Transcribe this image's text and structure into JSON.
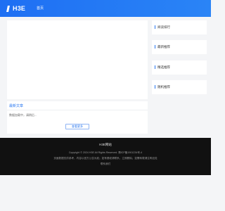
{
  "header": {
    "logo_text": "H3E",
    "nav_home": "首页"
  },
  "main": {
    "panel_title": "最新文章",
    "empty_text": "数据加载中，请稍后...",
    "view_more": "查看更多"
  },
  "sidebar": {
    "items": [
      {
        "label": "阅读排行",
        "icon": "bar-marker"
      },
      {
        "label": "最新推荐",
        "icon": "bar-marker"
      },
      {
        "label": "精选推荐",
        "icon": "bar-marker"
      },
      {
        "label": "随机推荐",
        "icon": "bar-marker"
      }
    ]
  },
  "footer": {
    "title": "H3E网站",
    "copyright": "Copyright © 2024 H3E All Rights Reserved. 豫ICP备1901234号-4",
    "disclaimer": "页面数据仅供参考，内容以官方公告为准；如有侵权请联系，立即删除；如需转载请注明出处",
    "contact": "联系我们"
  },
  "colors": {
    "header_start": "#1e6ff3",
    "header_end": "#2a84f6",
    "accent": "#2a77f0",
    "footer_bg": "#111111",
    "page_bg": "#f4f5f7"
  }
}
